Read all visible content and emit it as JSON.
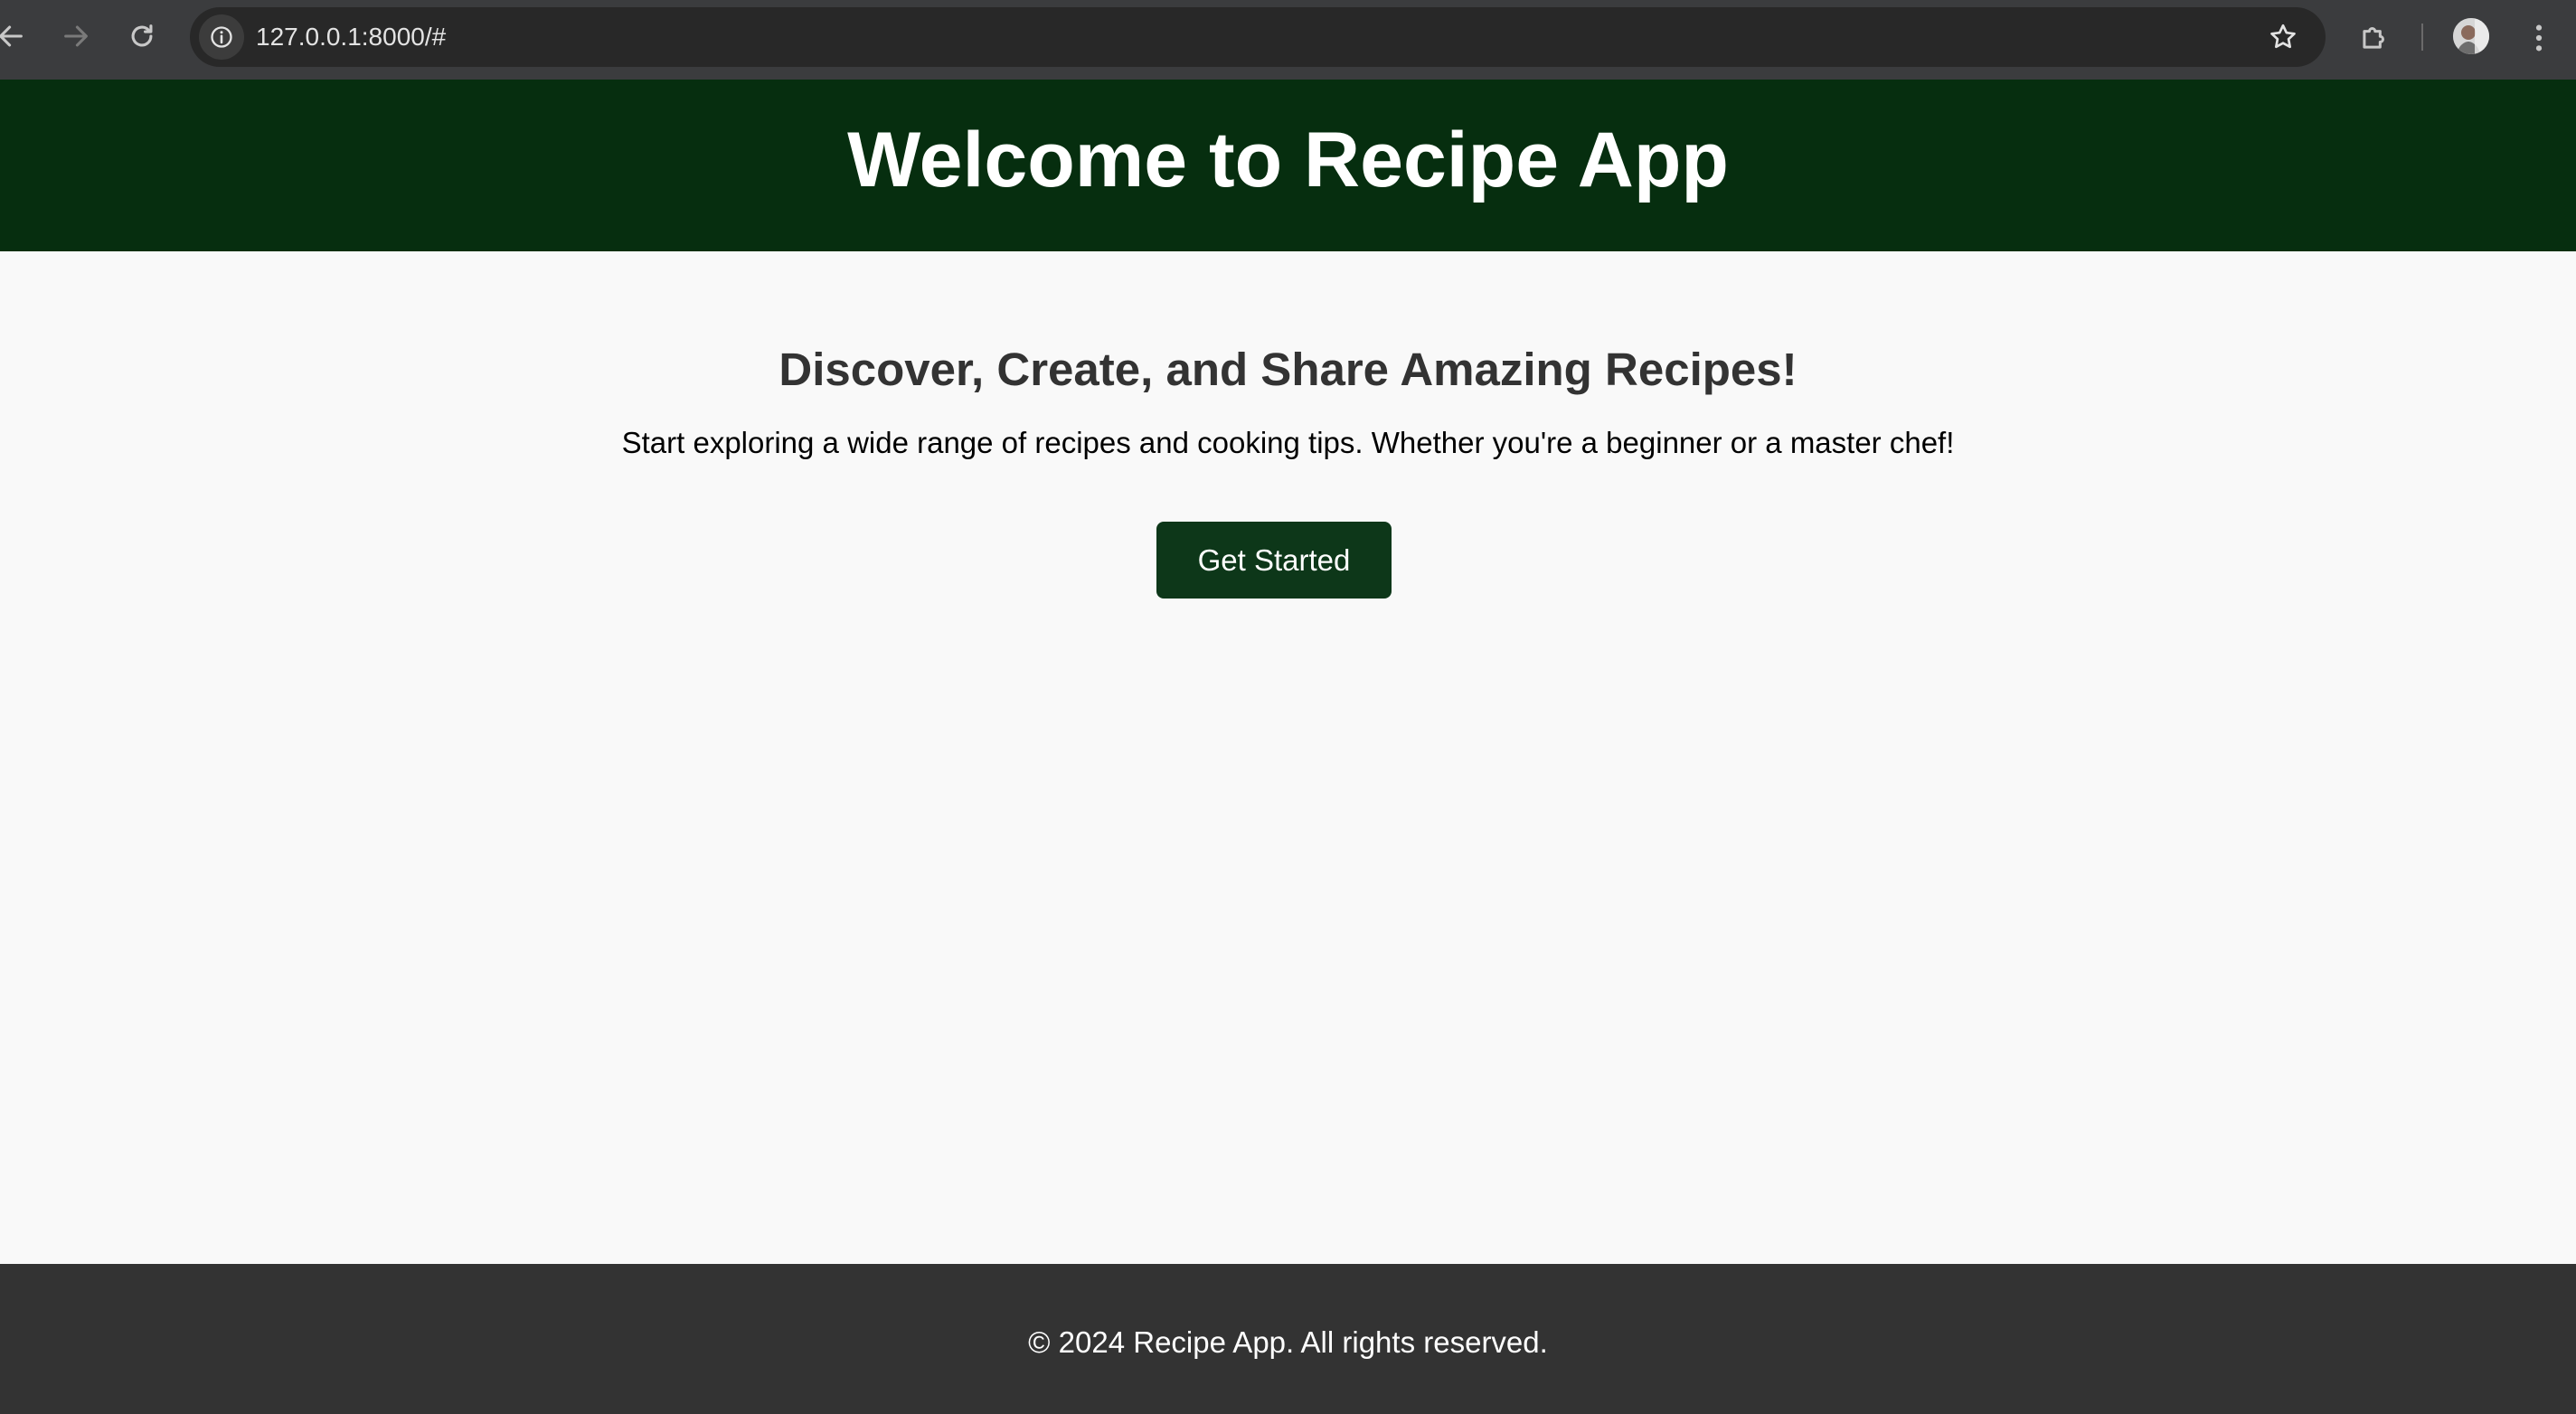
{
  "browser": {
    "url": "127.0.0.1:8000/#",
    "icons": {
      "back": "arrow-left-icon",
      "forward": "arrow-right-icon",
      "reload": "reload-icon",
      "site_info": "info-icon",
      "bookmark": "star-icon",
      "extensions": "puzzle-icon",
      "profile": "avatar",
      "menu": "kebab-menu-icon"
    }
  },
  "header": {
    "title": "Welcome to Recipe App",
    "background": "#062e0f"
  },
  "main": {
    "heading": "Discover, Create, and Share Amazing Recipes!",
    "description": "Start exploring a wide range of recipes and cooking tips. Whether you're a beginner or a master chef!",
    "cta_label": "Get Started",
    "cta_color": "#0d3719"
  },
  "footer": {
    "text": "© 2024 Recipe App. All rights reserved.",
    "background": "#333333"
  }
}
